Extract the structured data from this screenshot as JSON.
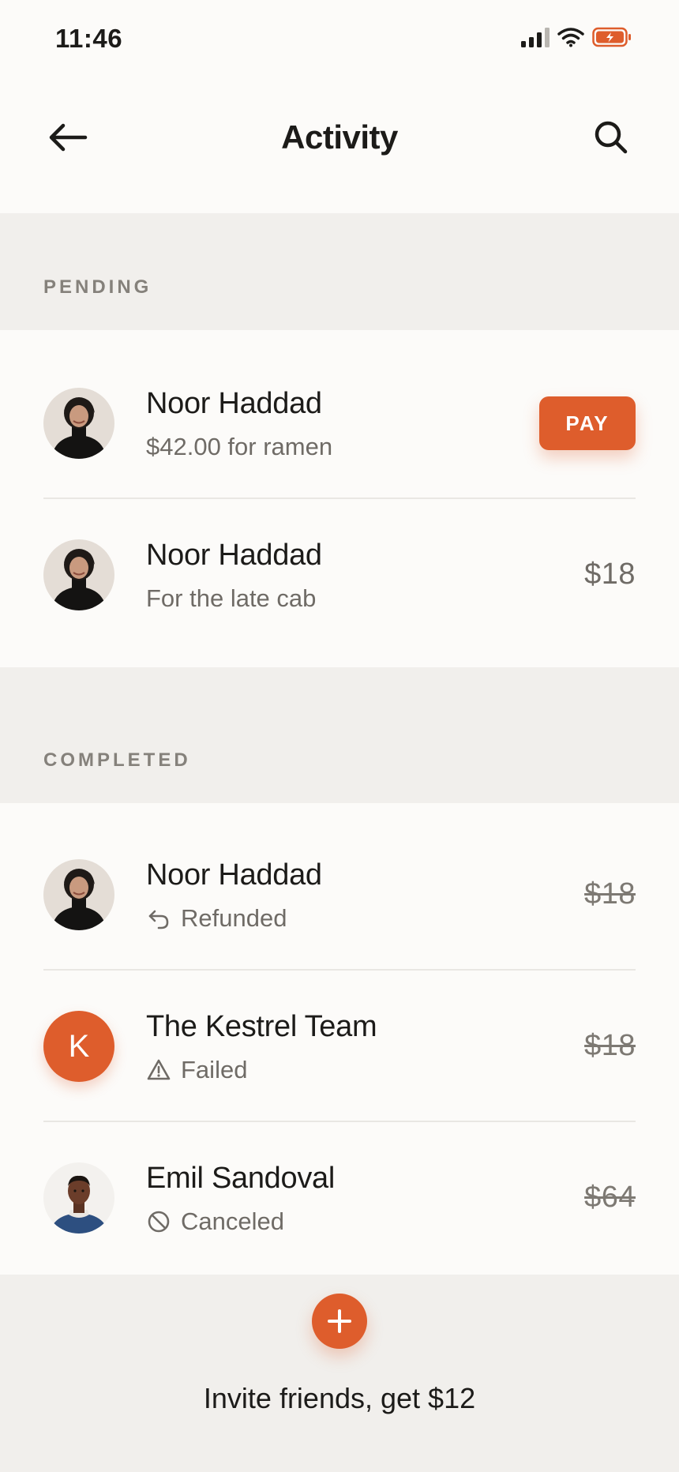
{
  "status_bar": {
    "time": "11:46",
    "icons": [
      "signal-icon",
      "wifi-icon",
      "battery-charging-icon"
    ]
  },
  "nav": {
    "title": "Activity",
    "back_icon": "arrow-left-icon",
    "search_icon": "search-icon"
  },
  "colors": {
    "accent": "#de5d2c",
    "background": "#fcfbf9",
    "section_background": "#f1efec",
    "muted_text": "#6f6b66"
  },
  "sections": {
    "pending": {
      "label": "PENDING",
      "items": [
        {
          "name": "Noor Haddad",
          "subtitle": "$42.00 for ramen",
          "action": "PAY"
        },
        {
          "name": "Noor Haddad",
          "subtitle": "For the late cab",
          "amount": "$18"
        }
      ]
    },
    "completed": {
      "label": "COMPLETED",
      "items": [
        {
          "name": "Noor Haddad",
          "status": "Refunded",
          "status_icon": "refund-arrow-icon",
          "amount": "$18"
        },
        {
          "name": "The Kestrel Team",
          "initial": "K",
          "status": "Failed",
          "status_icon": "warning-triangle-icon",
          "amount": "$18"
        },
        {
          "name": "Emil Sandoval",
          "status": "Canceled",
          "status_icon": "canceled-circle-icon",
          "amount": "$64"
        }
      ]
    }
  },
  "footer": {
    "add_icon": "plus-icon",
    "invite_text": "Invite friends, get $12"
  }
}
